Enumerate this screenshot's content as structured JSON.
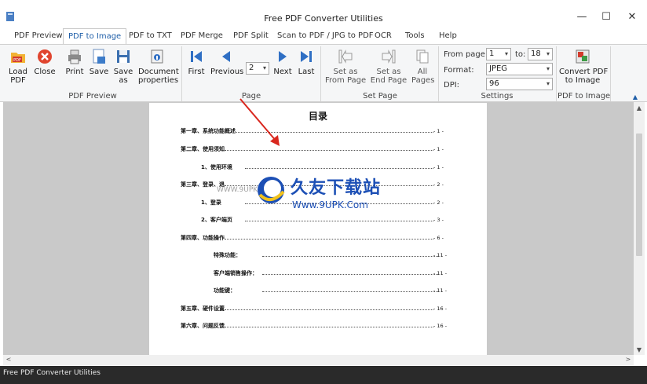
{
  "window": {
    "title": "Free PDF Converter Utilities",
    "minimize": "—",
    "maximize": "☐",
    "close": "✕"
  },
  "menu": {
    "tabs": [
      "PDF Preview",
      "PDF to Image",
      "PDF to TXT",
      "PDF Merge",
      "PDF Split",
      "Scan to PDF / JPG to PDF",
      "OCR",
      "Tools",
      "Help"
    ],
    "active": "PDF to Image"
  },
  "ribbon": {
    "preview_group": {
      "label": "PDF Preview",
      "buttons": {
        "load": "Load\nPDF",
        "close": "Close",
        "print": "Print",
        "save": "Save",
        "save_as": "Save\nas",
        "doc_props": "Document\nproperties"
      }
    },
    "page_group": {
      "label": "Page",
      "buttons": {
        "first": "First",
        "previous": "Previous",
        "next": "Next",
        "last": "Last"
      },
      "page_value": "2"
    },
    "set_page_group": {
      "label": "Set Page",
      "buttons": {
        "set_from": "Set as\nFrom Page",
        "set_end": "Set as\nEnd Page",
        "all": "All\nPages"
      }
    },
    "settings_group": {
      "label": "Settings",
      "from_page_label": "From page:",
      "from_page_value": "1",
      "to_label": "to:",
      "to_value": "18",
      "format_label": "Format:",
      "format_value": "JPEG",
      "dpi_label": "DPI:",
      "dpi_value": "96"
    },
    "convert_group": {
      "label": "PDF to Image",
      "button": "Convert PDF\nto Image"
    },
    "collapse": "▲"
  },
  "document": {
    "toc_title": "目录",
    "entries": [
      {
        "text": "第一章、系统功能概述",
        "page": "- 1 -"
      },
      {
        "text": "第二章、使用须知",
        "page": "- 1 -"
      },
      {
        "text": "1、使用环境",
        "page": "- 1 -"
      },
      {
        "text": "第三章、登录、退",
        "page": "- 2 -"
      },
      {
        "text": "1、登录",
        "page": "- 2 -"
      },
      {
        "text": "2、客户端页",
        "page": "- 3 -"
      },
      {
        "text": "第四章、功能操作",
        "page": "- 6 -"
      },
      {
        "text": "特殊功能：",
        "page": "- 11 -"
      },
      {
        "text": "客户端销售操作：",
        "page": "- 11 -"
      },
      {
        "text": "功能键：",
        "page": "- 11 -"
      },
      {
        "text": "第五章、硬件设置",
        "page": "- 16 -"
      },
      {
        "text": "第六章、问题反馈",
        "page": "- 16 -"
      }
    ],
    "watermark": {
      "main": "久友下载站",
      "sub": "Www.9UPK.Com",
      "faint": "WWW.9UPK.COM"
    }
  },
  "scrollbars": {
    "up": "▲",
    "down": "▼",
    "left": "<",
    "right": ">"
  },
  "status": {
    "text": "Free PDF Converter Utilities"
  },
  "colors": {
    "accent": "#1e5ea8",
    "status_bg": "#2a2a2a",
    "doc_bg": "#c9c9c9",
    "arrow": "#d9271e"
  }
}
